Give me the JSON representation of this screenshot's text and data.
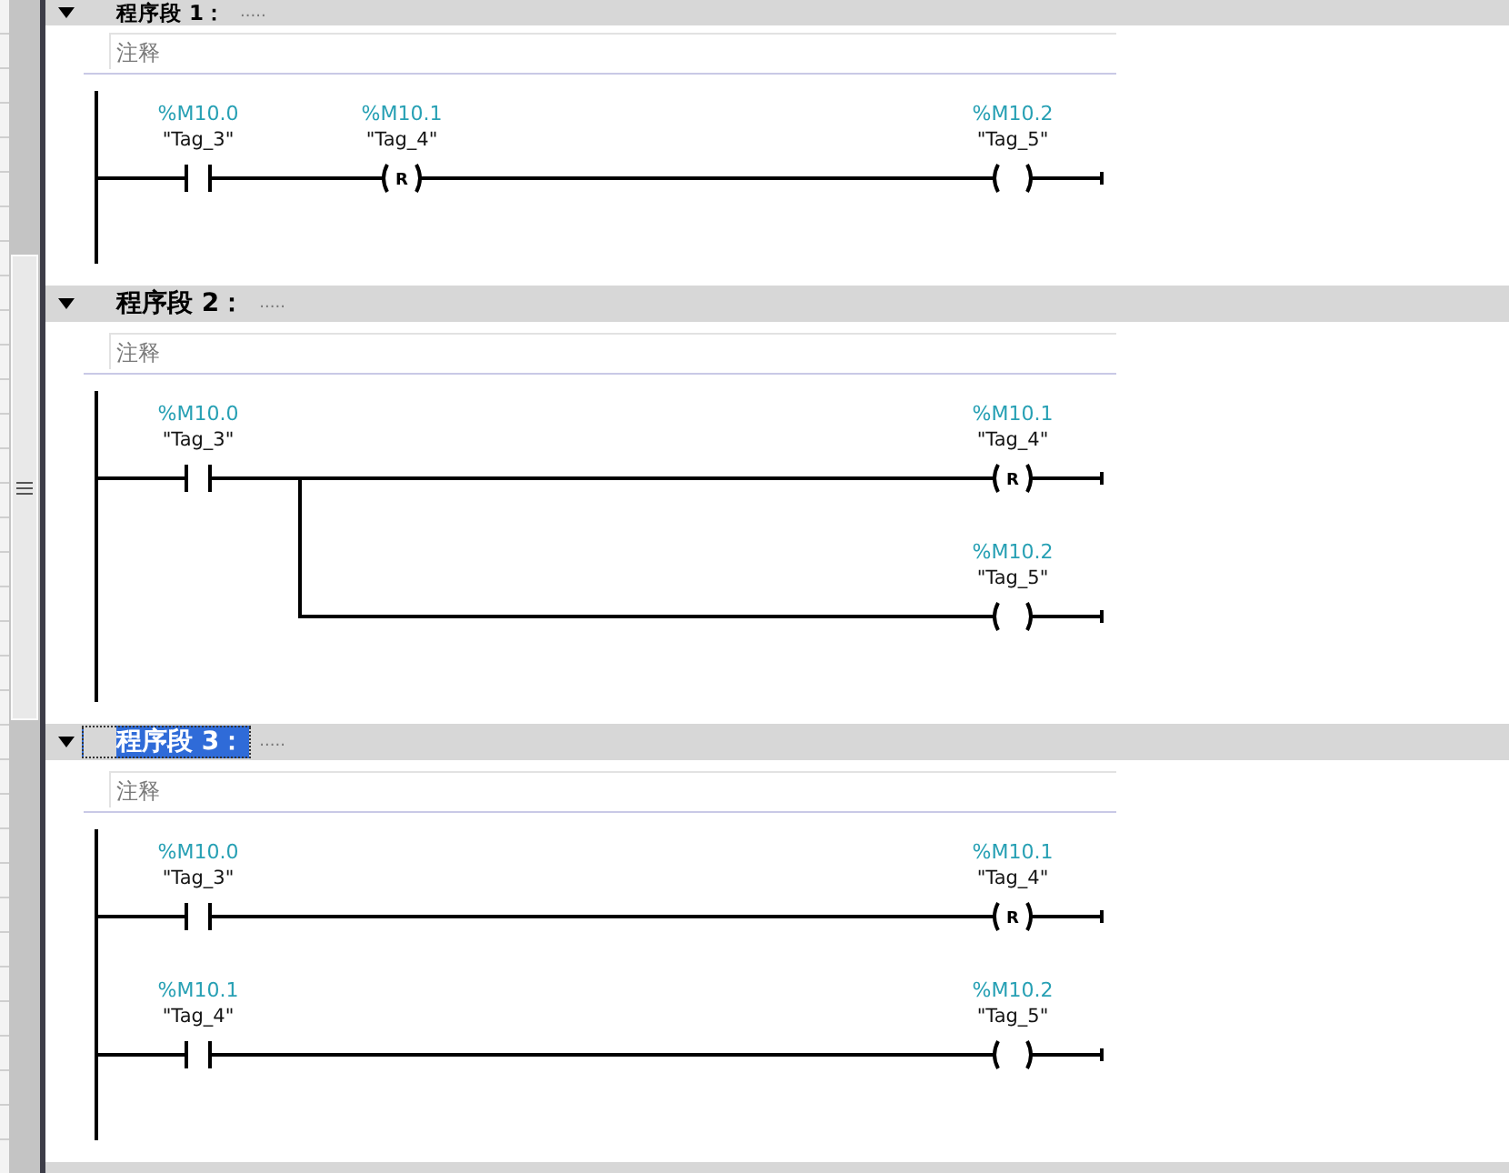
{
  "networks": [
    {
      "title": "程序段 1：",
      "title_placeholder": ".....",
      "expanded": true,
      "selected": false,
      "comment_placeholder": "注释",
      "rungs": [
        {
          "kind": "series",
          "elements": [
            {
              "kind": "contact",
              "address": "%M10.0",
              "tag": "\"Tag_3\""
            },
            {
              "kind": "coil",
              "letter": "R",
              "address": "%M10.1",
              "tag": "\"Tag_4\""
            },
            {
              "kind": "coil",
              "address": "%M10.2",
              "tag": "\"Tag_5\""
            }
          ]
        }
      ]
    },
    {
      "title": "程序段 2：",
      "title_placeholder": ".....",
      "expanded": true,
      "selected": false,
      "comment_placeholder": "注释",
      "rungs": [
        {
          "kind": "series",
          "elements": [
            {
              "kind": "contact",
              "address": "%M10.0",
              "tag": "\"Tag_3\""
            },
            {
              "kind": "coil",
              "letter": "R",
              "address": "%M10.1",
              "tag": "\"Tag_4\""
            }
          ]
        },
        {
          "kind": "branch",
          "elements": [
            {
              "kind": "coil",
              "address": "%M10.2",
              "tag": "\"Tag_5\""
            }
          ]
        }
      ]
    },
    {
      "title": "程序段 3：",
      "title_placeholder": ".....",
      "expanded": true,
      "selected": true,
      "comment_placeholder": "注释",
      "rungs": [
        {
          "kind": "series",
          "elements": [
            {
              "kind": "contact",
              "address": "%M10.0",
              "tag": "\"Tag_3\""
            },
            {
              "kind": "coil",
              "letter": "R",
              "address": "%M10.1",
              "tag": "\"Tag_4\""
            }
          ]
        },
        {
          "kind": "series",
          "elements": [
            {
              "kind": "contact",
              "address": "%M10.1",
              "tag": "\"Tag_4\""
            },
            {
              "kind": "coil",
              "address": "%M10.2",
              "tag": "\"Tag_5\""
            }
          ]
        }
      ]
    }
  ]
}
